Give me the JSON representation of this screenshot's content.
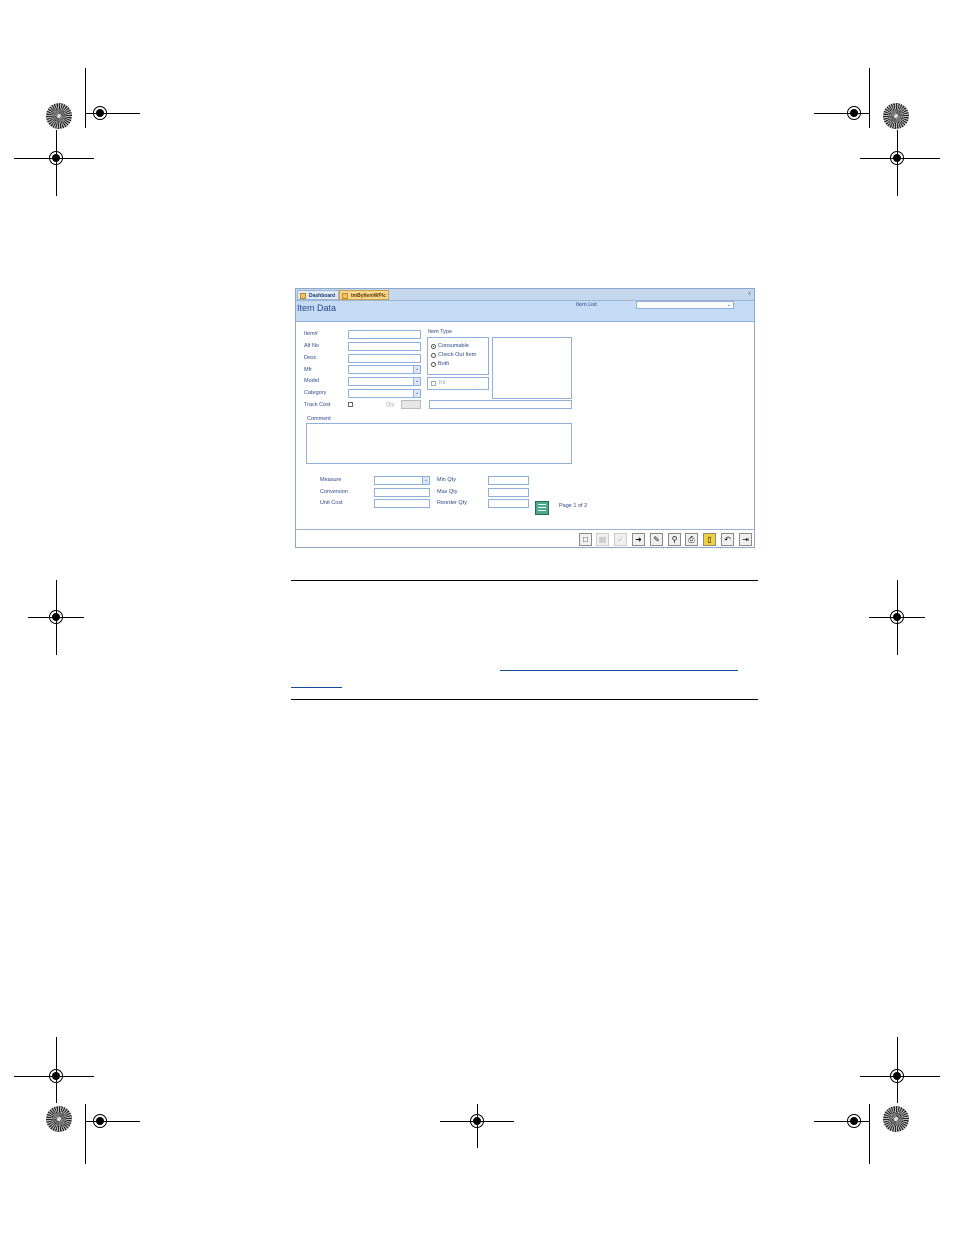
{
  "tabs": {
    "tab1_label": "Dashboard",
    "tab2_label": "tmByItemWPic",
    "close_label": "x"
  },
  "header": {
    "form_title": "Item Data",
    "item_list_label": "Item List",
    "item_list_value": ""
  },
  "fields": {
    "item_no_label": "Item#",
    "alt_no_label": "Alt No",
    "desc_label": "Desc",
    "mfr_label": "Mfr",
    "model_label": "Model",
    "category_label": "Category",
    "track_cost_label": "Track Cost",
    "qty_label": "Qty",
    "comment_label": "Comment"
  },
  "item_type": {
    "label": "Item Type",
    "options": [
      "Consumable",
      "Check Out Item",
      "Both"
    ],
    "selected": "Consumable",
    "kit_label": "Kit"
  },
  "lower": {
    "measure_label": "Measure",
    "conversion_label": "Conversion",
    "unit_cost_label": "Unit Cost",
    "min_qty_label": "Min Qty",
    "max_qty_label": "Max Qty",
    "reorder_qty_label": "Reorder Qty",
    "page_indicator": "Page 1 of 2"
  },
  "toolbar": {
    "buttons": [
      "new-record",
      "calendar",
      "save",
      "next",
      "edit",
      "find",
      "print",
      "delete",
      "undo",
      "close"
    ]
  },
  "colors": {
    "accent": "#2a4a8a",
    "header_bg": "#c5daf4",
    "border": "#8fb0db"
  }
}
